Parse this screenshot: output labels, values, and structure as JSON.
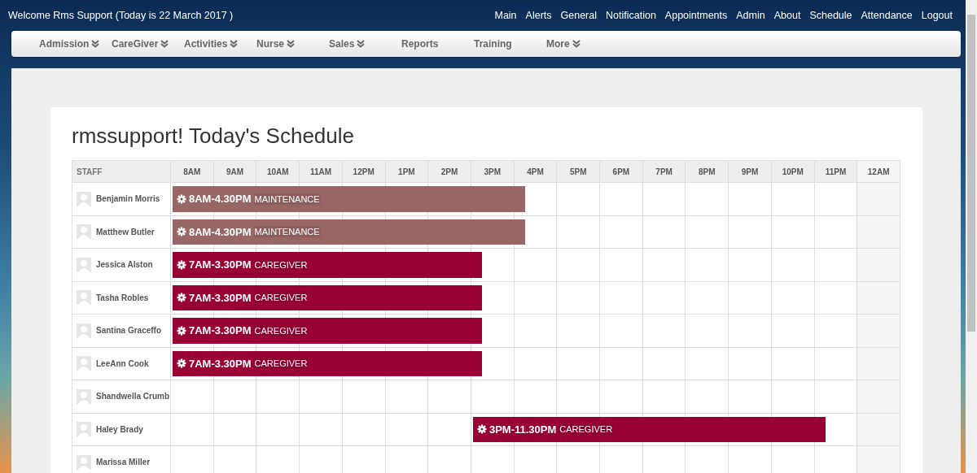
{
  "header": {
    "welcome": "Welcome Rms Support (Today is 22 March 2017 )",
    "links": [
      "Main",
      "Alerts",
      "General",
      "Notification",
      "Appointments",
      "Admin",
      "About",
      "Schedule",
      "Attendance",
      "Logout"
    ]
  },
  "menu": [
    {
      "label": "Admission",
      "has_dropdown": true
    },
    {
      "label": "CareGiver",
      "has_dropdown": true
    },
    {
      "label": "Activities",
      "has_dropdown": true
    },
    {
      "label": "Nurse",
      "has_dropdown": true
    },
    {
      "label": "Sales",
      "has_dropdown": true
    },
    {
      "label": "Reports",
      "has_dropdown": false
    },
    {
      "label": "Training",
      "has_dropdown": false
    },
    {
      "label": "More",
      "has_dropdown": true
    }
  ],
  "schedule": {
    "title": "rmssupport! Today's Schedule",
    "columns": [
      "STAFF",
      "8AM",
      "9AM",
      "10AM",
      "11AM",
      "12PM",
      "1PM",
      "2PM",
      "3PM",
      "4PM",
      "5PM",
      "6PM",
      "7PM",
      "8PM",
      "9PM",
      "10PM",
      "11PM",
      "12AM"
    ],
    "rows": [
      {
        "name": "Benjamin Morris",
        "shift": {
          "time": "8AM-4.30PM",
          "role": "MAINTENANCE",
          "color": "#996666"
        },
        "cells": [
          {
            "kind": "shift"
          },
          {
            "kind": "shift"
          },
          {
            "kind": "shift"
          },
          {
            "kind": "shift"
          },
          {
            "kind": "shift"
          },
          {
            "kind": "shift"
          },
          {
            "kind": "shift"
          },
          {
            "kind": "shift"
          },
          {
            "kind": "shift_end"
          },
          {
            "kind": "free"
          },
          {
            "kind": "free"
          },
          {
            "kind": "free"
          },
          {
            "kind": "free"
          },
          {
            "kind": "free"
          },
          {
            "kind": "free"
          },
          {
            "kind": "free"
          },
          {
            "kind": "free"
          }
        ]
      },
      {
        "name": "Matthew Butler",
        "shift": {
          "time": "8AM-4.30PM",
          "role": "MAINTENANCE",
          "color": "#996666"
        },
        "cells": [
          {
            "kind": "shift"
          },
          {
            "kind": "shift"
          },
          {
            "kind": "shift"
          },
          {
            "kind": "shift"
          },
          {
            "kind": "shift"
          },
          {
            "kind": "shift"
          },
          {
            "kind": "shift"
          },
          {
            "kind": "shift"
          },
          {
            "kind": "shift_end"
          },
          {
            "kind": "free"
          },
          {
            "kind": "free"
          },
          {
            "kind": "free"
          },
          {
            "kind": "free"
          },
          {
            "kind": "free"
          },
          {
            "kind": "free"
          },
          {
            "kind": "free"
          },
          {
            "kind": "free"
          }
        ]
      },
      {
        "name": "Jessica Alston",
        "shift": {
          "time": "7AM-3.30PM",
          "role": "CAREGIVER",
          "color": "#990033"
        },
        "cells": [
          {
            "kind": "shift"
          },
          {
            "kind": "shift"
          },
          {
            "kind": "shift"
          },
          {
            "kind": "shift"
          },
          {
            "kind": "shift"
          },
          {
            "kind": "shift"
          },
          {
            "kind": "shift"
          },
          {
            "kind": "shift_end"
          },
          {
            "kind": "free"
          },
          {
            "kind": "free"
          },
          {
            "kind": "free"
          },
          {
            "kind": "free"
          },
          {
            "kind": "free"
          },
          {
            "kind": "free"
          },
          {
            "kind": "free"
          },
          {
            "kind": "free"
          },
          {
            "kind": "free"
          }
        ]
      },
      {
        "name": "Tasha Robles",
        "shift": {
          "time": "7AM-3.30PM",
          "role": "CAREGIVER",
          "color": "#990033"
        },
        "cells": [
          {
            "kind": "shift"
          },
          {
            "kind": "shift"
          },
          {
            "kind": "shift"
          },
          {
            "kind": "shift"
          },
          {
            "kind": "shift"
          },
          {
            "kind": "shift"
          },
          {
            "kind": "shift"
          },
          {
            "kind": "shift_end"
          },
          {
            "kind": "free"
          },
          {
            "kind": "free"
          },
          {
            "kind": "free"
          },
          {
            "kind": "free"
          },
          {
            "kind": "free"
          },
          {
            "kind": "free"
          },
          {
            "kind": "free"
          },
          {
            "kind": "free"
          },
          {
            "kind": "free"
          }
        ]
      },
      {
        "name": "Santina Graceffo",
        "shift": {
          "time": "7AM-3.30PM",
          "role": "CAREGIVER",
          "color": "#990033"
        },
        "cells": [
          {
            "kind": "shift"
          },
          {
            "kind": "shift"
          },
          {
            "kind": "shift"
          },
          {
            "kind": "shift"
          },
          {
            "kind": "shift"
          },
          {
            "kind": "shift"
          },
          {
            "kind": "shift"
          },
          {
            "kind": "shift_end"
          },
          {
            "kind": "free"
          },
          {
            "kind": "free"
          },
          {
            "kind": "free"
          },
          {
            "kind": "free"
          },
          {
            "kind": "free"
          },
          {
            "kind": "free"
          },
          {
            "kind": "free"
          },
          {
            "kind": "free"
          },
          {
            "kind": "free"
          }
        ]
      },
      {
        "name": "LeeAnn Cook",
        "shift": {
          "time": "7AM-3.30PM",
          "role": "CAREGIVER",
          "color": "#990033"
        },
        "cells": [
          {
            "kind": "shift"
          },
          {
            "kind": "shift"
          },
          {
            "kind": "shift"
          },
          {
            "kind": "shift"
          },
          {
            "kind": "shift"
          },
          {
            "kind": "shift"
          },
          {
            "kind": "shift"
          },
          {
            "kind": "shift_end"
          },
          {
            "kind": "free"
          },
          {
            "kind": "free"
          },
          {
            "kind": "free"
          },
          {
            "kind": "free"
          },
          {
            "kind": "free"
          },
          {
            "kind": "free"
          },
          {
            "kind": "free"
          },
          {
            "kind": "free"
          },
          {
            "kind": "free"
          }
        ]
      },
      {
        "name": "Shandwella Crumb"
      },
      {
        "name": "Haley Brady",
        "shift": {
          "time": "3PM-11.30PM",
          "role": "CAREGIVER",
          "color": "#990033"
        },
        "cells": [
          {
            "kind": "free"
          },
          {
            "kind": "free"
          },
          {
            "kind": "free"
          },
          {
            "kind": "free"
          },
          {
            "kind": "free"
          },
          {
            "kind": "free"
          },
          {
            "kind": "free"
          },
          {
            "kind": "shift"
          },
          {
            "kind": "shift"
          },
          {
            "kind": "shift"
          },
          {
            "kind": "shift"
          },
          {
            "kind": "shift"
          },
          {
            "kind": "shift"
          },
          {
            "kind": "shift"
          },
          {
            "kind": "shift"
          },
          {
            "kind": "shift_end"
          },
          {
            "kind": "free"
          }
        ]
      },
      {
        "name": "Marissa Miller"
      }
    ]
  }
}
